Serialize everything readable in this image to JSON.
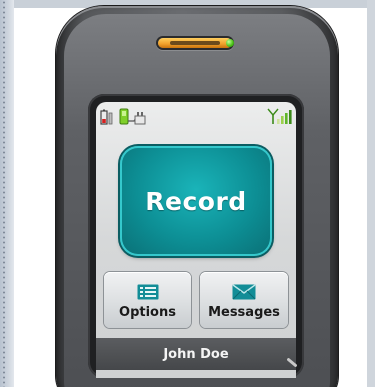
{
  "screen": {
    "status_bar": {
      "battery_icon": "battery-icon",
      "charger_icon": "charger-icon",
      "signal_icon": "signal-icon"
    },
    "record_button": {
      "label": "Record",
      "color": "#0d8f95"
    },
    "soft_buttons": [
      {
        "label": "Options",
        "icon": "list-icon",
        "icon_color": "#128d97"
      },
      {
        "label": "Messages",
        "icon": "envelope-icon",
        "icon_color": "#128d97"
      }
    ],
    "owner_name": "John Doe"
  },
  "device": {
    "speaker_color": "#f0a02b",
    "led_color": "#4cc41b",
    "body_color": "#5a5c5f"
  }
}
